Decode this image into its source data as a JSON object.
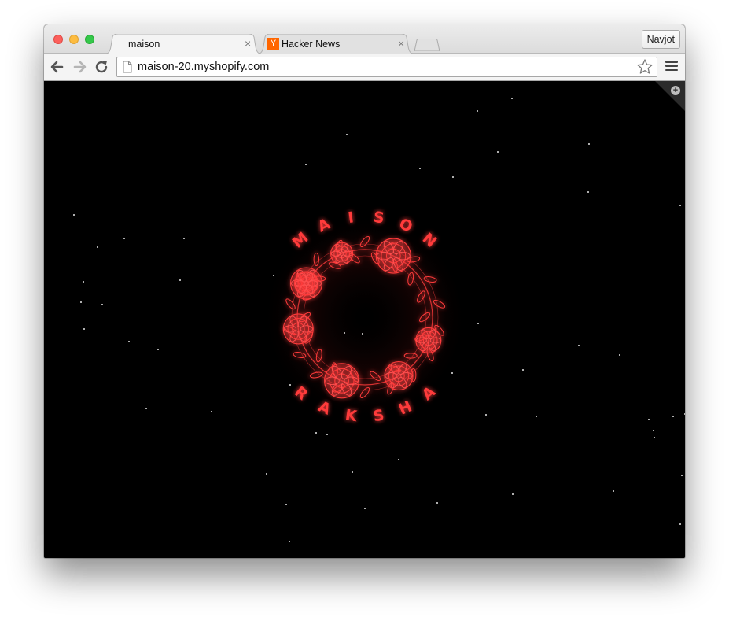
{
  "browser": {
    "tabs": [
      {
        "title": "maison",
        "active": true,
        "close": "×"
      },
      {
        "title": "Hacker News",
        "active": false,
        "close": "×",
        "favicon_letter": "Y"
      }
    ],
    "profile_name": "Navjot",
    "url": "maison-20.myshopify.com"
  },
  "page": {
    "logo_top_letters": [
      "M",
      "A",
      "I",
      "S",
      "O",
      "N"
    ],
    "logo_bottom_letters": [
      "R",
      "A",
      "K",
      "S",
      "H",
      "A"
    ],
    "colors": {
      "background": "#000000",
      "accent": "#ff3b3b"
    }
  }
}
